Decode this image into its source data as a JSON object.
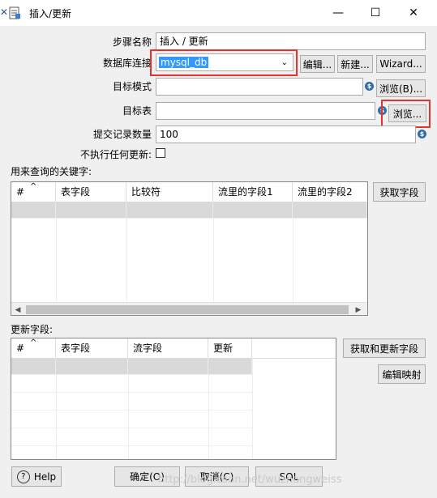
{
  "window": {
    "title": "插入/更新",
    "minimize": "—",
    "maximize": "☐",
    "close": "✕"
  },
  "form": {
    "step_name_label": "步骤名称",
    "step_name_value": "插入 / 更新",
    "connection_label": "数据库连接",
    "connection_value": "mysql_db",
    "edit_btn": "编辑...",
    "new_btn": "新建...",
    "wizard_btn": "Wizard...",
    "schema_label": "目标模式",
    "schema_value": "",
    "browse_schema_btn": "浏览(B)...",
    "table_label": "目标表",
    "table_value": "",
    "browse_table_btn": "浏览...",
    "commit_label": "提交记录数量",
    "commit_value": "100",
    "no_update_label": "不执行任何更新:"
  },
  "keys": {
    "section_label": "用来查询的关键字:",
    "get_fields_btn": "获取字段",
    "columns": [
      "#",
      "表字段",
      "比较符",
      "流里的字段1",
      "流里的字段2"
    ],
    "sort_indicator": "^"
  },
  "update": {
    "section_label": "更新字段:",
    "get_update_fields_btn": "获取和更新字段",
    "edit_mapping_btn": "编辑映射",
    "columns": [
      "#",
      "表字段",
      "流字段",
      "更新"
    ],
    "sort_indicator": "^"
  },
  "footer": {
    "help_btn": "Help",
    "ok_btn": "确定(O)",
    "cancel_btn": "取消(C)",
    "sql_btn": "SQL",
    "watermark": "http://blog.csdn.net/wuzhangweiss"
  },
  "colors": {
    "highlight": "#e8302f",
    "selection": "#3399ff"
  }
}
